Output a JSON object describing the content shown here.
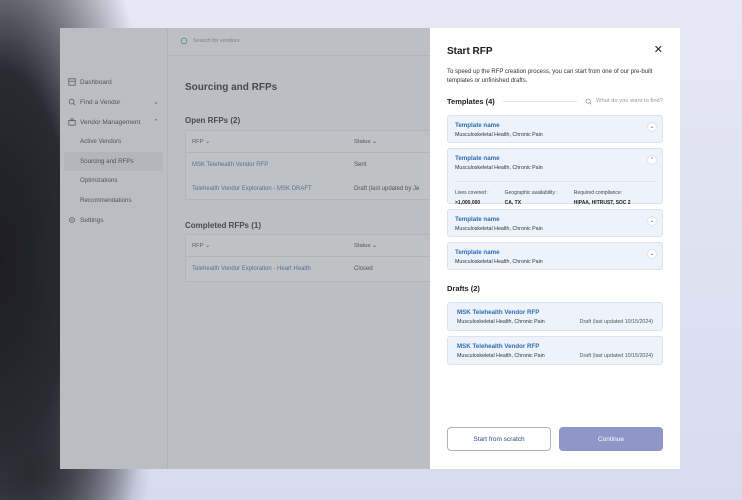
{
  "search": {
    "placeholder": "Search for vendors"
  },
  "sidebar": {
    "items": [
      {
        "label": "Dashboard",
        "icon": "dashboard-icon"
      },
      {
        "label": "Find a Vendor",
        "icon": "search-icon"
      },
      {
        "label": "Vendor Management",
        "icon": "briefcase-icon"
      }
    ],
    "sub_items": [
      {
        "label": "Active Vendors"
      },
      {
        "label": "Sourcing and RFPs"
      },
      {
        "label": "Optimizations"
      },
      {
        "label": "Recommendations"
      }
    ],
    "settings": {
      "label": "Settings",
      "icon": "gear-icon"
    }
  },
  "main": {
    "title": "Sourcing and RFPs",
    "open": {
      "title": "Open RFPs (2)",
      "headers": {
        "rfp": "RFP",
        "status": "Status"
      },
      "rows": [
        {
          "name": "MSK Telehealth Vendor RFP",
          "status": "Sent"
        },
        {
          "name": "Telehealth Vendor Exploration - MSK DRAFT",
          "status": "Draft (last updated by Je"
        }
      ]
    },
    "completed": {
      "title": "Completed RFPs (1)",
      "headers": {
        "rfp": "RFP",
        "status": "Status"
      },
      "rows": [
        {
          "name": "Telehealth Vendor Exploration - Heart Health",
          "status": "Closed"
        }
      ]
    }
  },
  "modal": {
    "title": "Start RFP",
    "description": "To speed up the RFP creation process, you can start from one of our pre-built templates or unfinished drafts.",
    "templates_label": "Templates (4)",
    "find_placeholder": "What do you want to find?",
    "templates": [
      {
        "name": "Template name",
        "sub": "Musculoskeletal Health, Chronic Pain"
      },
      {
        "name": "Template name",
        "sub": "Musculoskeletal Health, Chronic Pain",
        "details": [
          {
            "k": "Lives covered :",
            "v": ">1,000,000"
          },
          {
            "k": "Geographic availability :",
            "v": "CA, TX"
          },
          {
            "k": "Required compliance:",
            "v": "HIPAA, HITRUST, SOC 2"
          }
        ]
      },
      {
        "name": "Template name",
        "sub": "Musculoskeletal Health, Chronic Pain"
      },
      {
        "name": "Template name",
        "sub": "Musculoskeletal Health, Chronic Pain"
      }
    ],
    "drafts_label": "Drafts (2)",
    "drafts": [
      {
        "name": "MSK Telehealth Vendor RFP",
        "sub": "Musculoskeletal Health, Chronic Pain",
        "date": "Draft (last updated 10/15/2024)"
      },
      {
        "name": "MSK Telehealth Vendor RFP",
        "sub": "Musculoskeletal Health, Chronic Pain",
        "date": "Draft (last updated 10/15/2024)"
      }
    ],
    "btn_scratch": "Start from scratch",
    "btn_continue": "Continue"
  }
}
